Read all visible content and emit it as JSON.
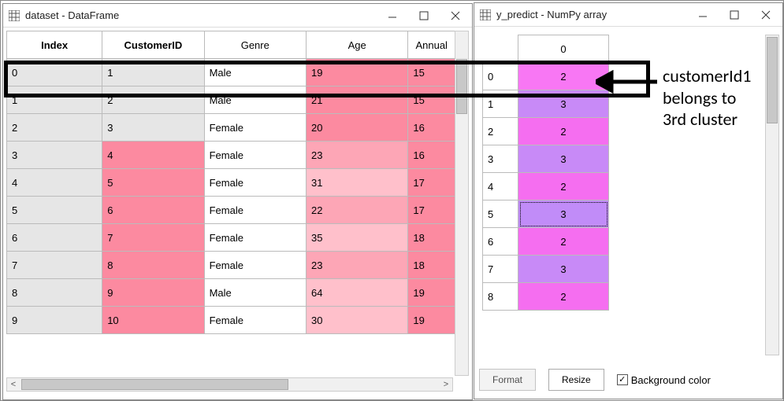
{
  "win1": {
    "title": "dataset - DataFrame",
    "headers": [
      "Index",
      "CustomerID",
      "Genre",
      "Age",
      "Annual"
    ],
    "rows": [
      {
        "idx": "0",
        "cid": "1",
        "genre": "Male",
        "age": "19",
        "ann": "15"
      },
      {
        "idx": "1",
        "cid": "2",
        "genre": "Male",
        "age": "21",
        "ann": "15"
      },
      {
        "idx": "2",
        "cid": "3",
        "genre": "Female",
        "age": "20",
        "ann": "16"
      },
      {
        "idx": "3",
        "cid": "4",
        "genre": "Female",
        "age": "23",
        "ann": "16"
      },
      {
        "idx": "4",
        "cid": "5",
        "genre": "Female",
        "age": "31",
        "ann": "17"
      },
      {
        "idx": "5",
        "cid": "6",
        "genre": "Female",
        "age": "22",
        "ann": "17"
      },
      {
        "idx": "6",
        "cid": "7",
        "genre": "Female",
        "age": "35",
        "ann": "18"
      },
      {
        "idx": "7",
        "cid": "8",
        "genre": "Female",
        "age": "23",
        "ann": "18"
      },
      {
        "idx": "8",
        "cid": "9",
        "genre": "Male",
        "age": "64",
        "ann": "19"
      },
      {
        "idx": "9",
        "cid": "10",
        "genre": "Female",
        "age": "30",
        "ann": "19"
      }
    ]
  },
  "win2": {
    "title": "y_predict - NumPy array",
    "header_val": "0",
    "rows": [
      {
        "idx": "0",
        "val": "2"
      },
      {
        "idx": "1",
        "val": "3"
      },
      {
        "idx": "2",
        "val": "2"
      },
      {
        "idx": "3",
        "val": "3"
      },
      {
        "idx": "4",
        "val": "2"
      },
      {
        "idx": "5",
        "val": "3"
      },
      {
        "idx": "6",
        "val": "2"
      },
      {
        "idx": "7",
        "val": "3"
      },
      {
        "idx": "8",
        "val": "2"
      }
    ],
    "format_btn": "Format",
    "resize_btn": "Resize",
    "bg_label": "Background color",
    "bg_checked": true
  },
  "annotation": {
    "line1": "customerId1",
    "line2": "belongs to",
    "line3": "3rd cluster"
  },
  "scroll_glyph_left": "<",
  "scroll_glyph_right": ">",
  "checkmark": "✓"
}
